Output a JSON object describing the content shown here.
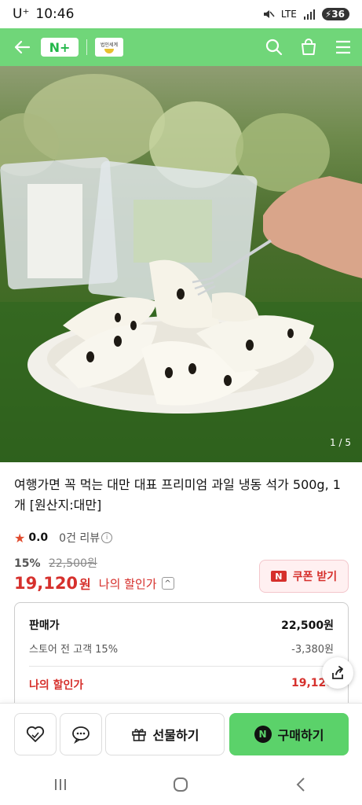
{
  "status_bar": {
    "carrier": "U⁺",
    "time": "10:46",
    "network": "LTE",
    "battery": "36"
  },
  "header": {
    "nplus_logo": "N+",
    "store_logo_text": "법인세계"
  },
  "hero": {
    "pager": "1 / 5"
  },
  "product": {
    "title": "여행가면 꼭 먹는 대만 대표 프리미엄 과일 냉동 석가 500g, 1개 [원산지:대만]",
    "rating": "0.0",
    "reviews": "0건 리뷰",
    "discount_rate": "15%",
    "original_price": "22,500원",
    "final_price": "19,120",
    "won": "원",
    "my_discount_label": "나의 할인가"
  },
  "coupon": {
    "badge": "N",
    "label": "쿠폰 받기"
  },
  "breakdown": {
    "rows": [
      {
        "label": "판매가",
        "value": "22,500원"
      },
      {
        "label": "스토어 전 고객 15%",
        "value": "-3,380원"
      },
      {
        "label": "나의 할인가",
        "value": "19,120"
      }
    ]
  },
  "actions": {
    "gift_label": "선물하기",
    "buy_icon": "N",
    "buy_label": "구매하기"
  },
  "colors": {
    "brand_green": "#70d679",
    "price_red": "#d6302c",
    "buy_green": "#5bd26a"
  },
  "icons": [
    "back-arrow-icon",
    "search-icon",
    "shopping-bag-icon",
    "menu-icon",
    "heart-icon",
    "talk-icon",
    "gift-icon",
    "share-icon",
    "recent-apps-icon",
    "home-icon",
    "back-icon"
  ]
}
